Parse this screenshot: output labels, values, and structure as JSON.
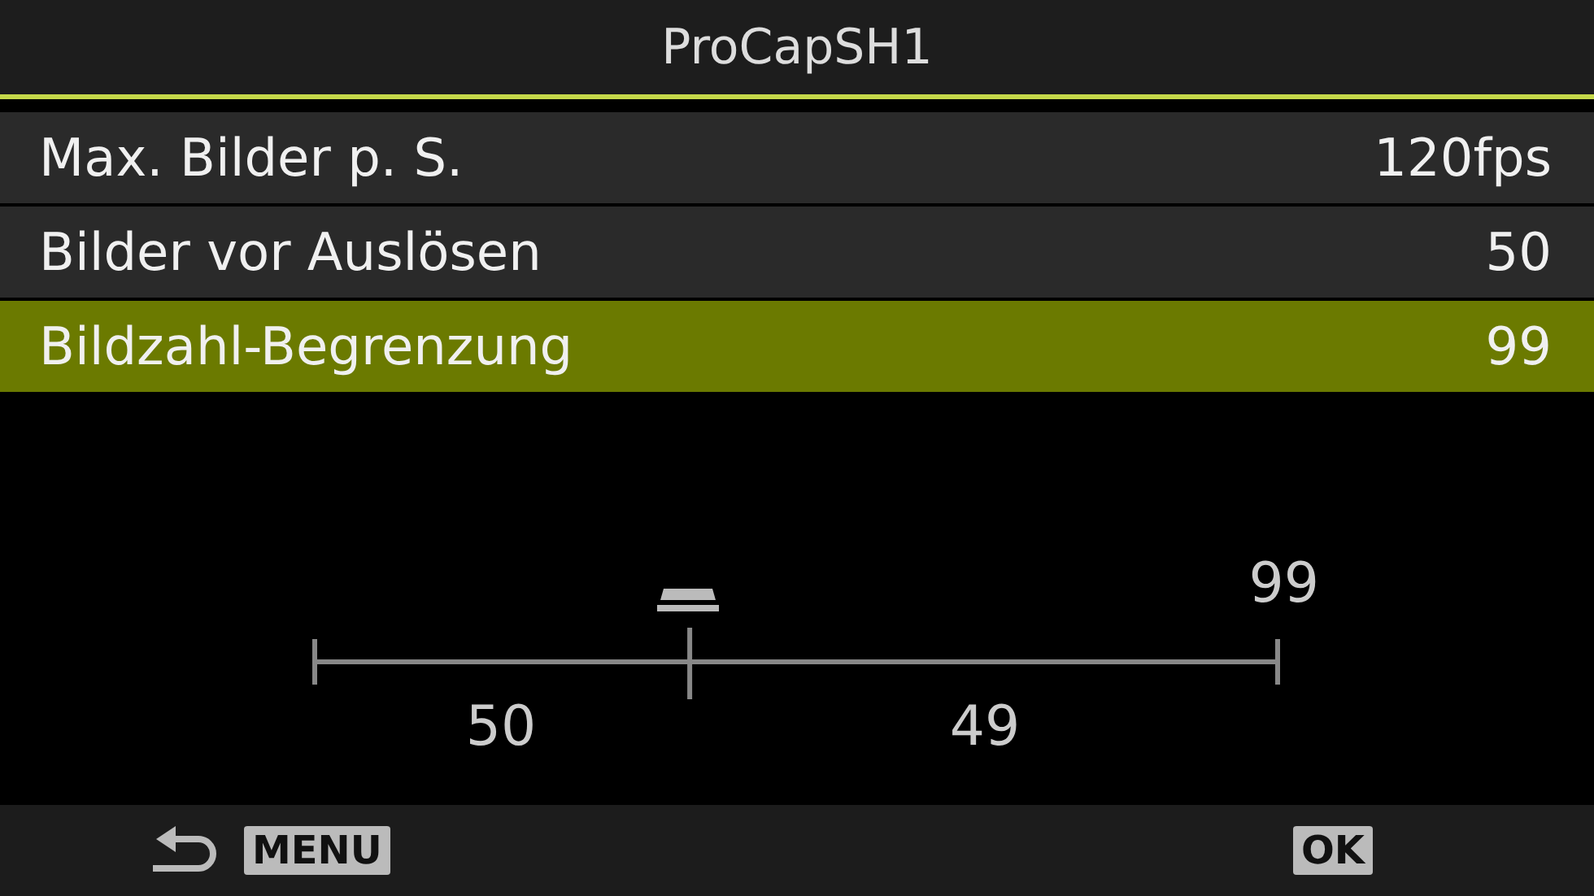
{
  "header": {
    "title": "ProCapSH1"
  },
  "rows": [
    {
      "label": "Max. Bilder p. S.",
      "value": "120fps",
      "selected": false
    },
    {
      "label": "Bilder vor Auslösen",
      "value": "50",
      "selected": false
    },
    {
      "label": "Bildzahl-Begrenzung",
      "value": "99",
      "selected": true
    }
  ],
  "slider": {
    "max_label": "99",
    "left_label": "50",
    "right_label": "49"
  },
  "footer": {
    "back_key": "MENU",
    "ok_key": "OK"
  }
}
